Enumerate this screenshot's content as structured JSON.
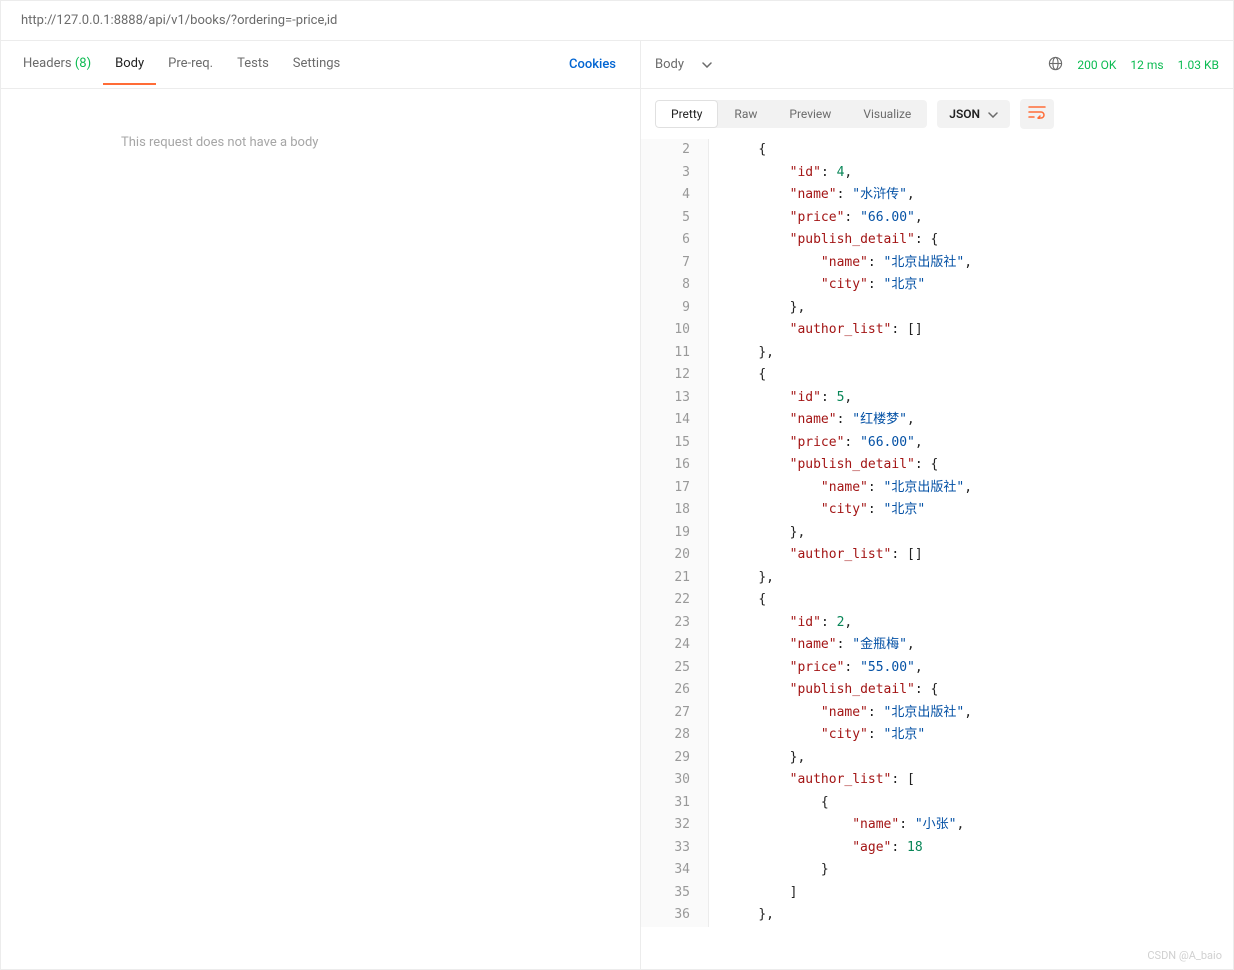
{
  "url": "http://127.0.0.1:8888/api/v1/books/?ordering=-price,id",
  "left_tabs": {
    "headers": {
      "label": "Headers",
      "count": "(8)"
    },
    "body": "Body",
    "prereq": "Pre-req.",
    "tests": "Tests",
    "settings": "Settings"
  },
  "cookies_link": "Cookies",
  "body_placeholder": "This request does not have a body",
  "response": {
    "body_label": "Body",
    "status": "200 OK",
    "time": "12 ms",
    "size": "1.03 KB"
  },
  "view_tabs": {
    "pretty": "Pretty",
    "raw": "Raw",
    "preview": "Preview",
    "visualize": "Visualize"
  },
  "format_label": "JSON",
  "code_lines": [
    {
      "n": "2",
      "indent": 1,
      "tokens": [
        {
          "t": "punc",
          "v": "{"
        }
      ]
    },
    {
      "n": "3",
      "indent": 2,
      "tokens": [
        {
          "t": "key",
          "v": "\"id\""
        },
        {
          "t": "punc",
          "v": ": "
        },
        {
          "t": "num",
          "v": "4"
        },
        {
          "t": "punc",
          "v": ","
        }
      ]
    },
    {
      "n": "4",
      "indent": 2,
      "tokens": [
        {
          "t": "key",
          "v": "\"name\""
        },
        {
          "t": "punc",
          "v": ": "
        },
        {
          "t": "str",
          "v": "\"水浒传\""
        },
        {
          "t": "punc",
          "v": ","
        }
      ]
    },
    {
      "n": "5",
      "indent": 2,
      "tokens": [
        {
          "t": "key",
          "v": "\"price\""
        },
        {
          "t": "punc",
          "v": ": "
        },
        {
          "t": "str",
          "v": "\"66.00\""
        },
        {
          "t": "punc",
          "v": ","
        }
      ]
    },
    {
      "n": "6",
      "indent": 2,
      "tokens": [
        {
          "t": "key",
          "v": "\"publish_detail\""
        },
        {
          "t": "punc",
          "v": ": {"
        }
      ]
    },
    {
      "n": "7",
      "indent": 3,
      "tokens": [
        {
          "t": "key",
          "v": "\"name\""
        },
        {
          "t": "punc",
          "v": ": "
        },
        {
          "t": "str",
          "v": "\"北京出版社\""
        },
        {
          "t": "punc",
          "v": ","
        }
      ]
    },
    {
      "n": "8",
      "indent": 3,
      "tokens": [
        {
          "t": "key",
          "v": "\"city\""
        },
        {
          "t": "punc",
          "v": ": "
        },
        {
          "t": "str",
          "v": "\"北京\""
        }
      ]
    },
    {
      "n": "9",
      "indent": 2,
      "tokens": [
        {
          "t": "punc",
          "v": "},"
        }
      ]
    },
    {
      "n": "10",
      "indent": 2,
      "tokens": [
        {
          "t": "key",
          "v": "\"author_list\""
        },
        {
          "t": "punc",
          "v": ": []"
        }
      ]
    },
    {
      "n": "11",
      "indent": 1,
      "tokens": [
        {
          "t": "punc",
          "v": "},"
        }
      ]
    },
    {
      "n": "12",
      "indent": 1,
      "tokens": [
        {
          "t": "punc",
          "v": "{"
        }
      ]
    },
    {
      "n": "13",
      "indent": 2,
      "tokens": [
        {
          "t": "key",
          "v": "\"id\""
        },
        {
          "t": "punc",
          "v": ": "
        },
        {
          "t": "num",
          "v": "5"
        },
        {
          "t": "punc",
          "v": ","
        }
      ]
    },
    {
      "n": "14",
      "indent": 2,
      "tokens": [
        {
          "t": "key",
          "v": "\"name\""
        },
        {
          "t": "punc",
          "v": ": "
        },
        {
          "t": "str",
          "v": "\"红楼梦\""
        },
        {
          "t": "punc",
          "v": ","
        }
      ]
    },
    {
      "n": "15",
      "indent": 2,
      "tokens": [
        {
          "t": "key",
          "v": "\"price\""
        },
        {
          "t": "punc",
          "v": ": "
        },
        {
          "t": "str",
          "v": "\"66.00\""
        },
        {
          "t": "punc",
          "v": ","
        }
      ]
    },
    {
      "n": "16",
      "indent": 2,
      "tokens": [
        {
          "t": "key",
          "v": "\"publish_detail\""
        },
        {
          "t": "punc",
          "v": ": {"
        }
      ]
    },
    {
      "n": "17",
      "indent": 3,
      "tokens": [
        {
          "t": "key",
          "v": "\"name\""
        },
        {
          "t": "punc",
          "v": ": "
        },
        {
          "t": "str",
          "v": "\"北京出版社\""
        },
        {
          "t": "punc",
          "v": ","
        }
      ]
    },
    {
      "n": "18",
      "indent": 3,
      "tokens": [
        {
          "t": "key",
          "v": "\"city\""
        },
        {
          "t": "punc",
          "v": ": "
        },
        {
          "t": "str",
          "v": "\"北京\""
        }
      ]
    },
    {
      "n": "19",
      "indent": 2,
      "tokens": [
        {
          "t": "punc",
          "v": "},"
        }
      ]
    },
    {
      "n": "20",
      "indent": 2,
      "tokens": [
        {
          "t": "key",
          "v": "\"author_list\""
        },
        {
          "t": "punc",
          "v": ": []"
        }
      ]
    },
    {
      "n": "21",
      "indent": 1,
      "tokens": [
        {
          "t": "punc",
          "v": "},"
        }
      ]
    },
    {
      "n": "22",
      "indent": 1,
      "tokens": [
        {
          "t": "punc",
          "v": "{"
        }
      ]
    },
    {
      "n": "23",
      "indent": 2,
      "tokens": [
        {
          "t": "key",
          "v": "\"id\""
        },
        {
          "t": "punc",
          "v": ": "
        },
        {
          "t": "num",
          "v": "2"
        },
        {
          "t": "punc",
          "v": ","
        }
      ]
    },
    {
      "n": "24",
      "indent": 2,
      "tokens": [
        {
          "t": "key",
          "v": "\"name\""
        },
        {
          "t": "punc",
          "v": ": "
        },
        {
          "t": "str",
          "v": "\"金瓶梅\""
        },
        {
          "t": "punc",
          "v": ","
        }
      ]
    },
    {
      "n": "25",
      "indent": 2,
      "tokens": [
        {
          "t": "key",
          "v": "\"price\""
        },
        {
          "t": "punc",
          "v": ": "
        },
        {
          "t": "str",
          "v": "\"55.00\""
        },
        {
          "t": "punc",
          "v": ","
        }
      ]
    },
    {
      "n": "26",
      "indent": 2,
      "tokens": [
        {
          "t": "key",
          "v": "\"publish_detail\""
        },
        {
          "t": "punc",
          "v": ": {"
        }
      ]
    },
    {
      "n": "27",
      "indent": 3,
      "tokens": [
        {
          "t": "key",
          "v": "\"name\""
        },
        {
          "t": "punc",
          "v": ": "
        },
        {
          "t": "str",
          "v": "\"北京出版社\""
        },
        {
          "t": "punc",
          "v": ","
        }
      ]
    },
    {
      "n": "28",
      "indent": 3,
      "tokens": [
        {
          "t": "key",
          "v": "\"city\""
        },
        {
          "t": "punc",
          "v": ": "
        },
        {
          "t": "str",
          "v": "\"北京\""
        }
      ]
    },
    {
      "n": "29",
      "indent": 2,
      "tokens": [
        {
          "t": "punc",
          "v": "},"
        }
      ]
    },
    {
      "n": "30",
      "indent": 2,
      "tokens": [
        {
          "t": "key",
          "v": "\"author_list\""
        },
        {
          "t": "punc",
          "v": ": ["
        }
      ]
    },
    {
      "n": "31",
      "indent": 3,
      "tokens": [
        {
          "t": "punc",
          "v": "{"
        }
      ]
    },
    {
      "n": "32",
      "indent": 4,
      "tokens": [
        {
          "t": "key",
          "v": "\"name\""
        },
        {
          "t": "punc",
          "v": ": "
        },
        {
          "t": "str",
          "v": "\"小张\""
        },
        {
          "t": "punc",
          "v": ","
        }
      ]
    },
    {
      "n": "33",
      "indent": 4,
      "tokens": [
        {
          "t": "key",
          "v": "\"age\""
        },
        {
          "t": "punc",
          "v": ": "
        },
        {
          "t": "num",
          "v": "18"
        }
      ]
    },
    {
      "n": "34",
      "indent": 3,
      "tokens": [
        {
          "t": "punc",
          "v": "}"
        }
      ]
    },
    {
      "n": "35",
      "indent": 2,
      "tokens": [
        {
          "t": "punc",
          "v": "]"
        }
      ]
    },
    {
      "n": "36",
      "indent": 1,
      "tokens": [
        {
          "t": "punc",
          "v": "},"
        }
      ]
    }
  ],
  "watermark": "CSDN @A_baio"
}
